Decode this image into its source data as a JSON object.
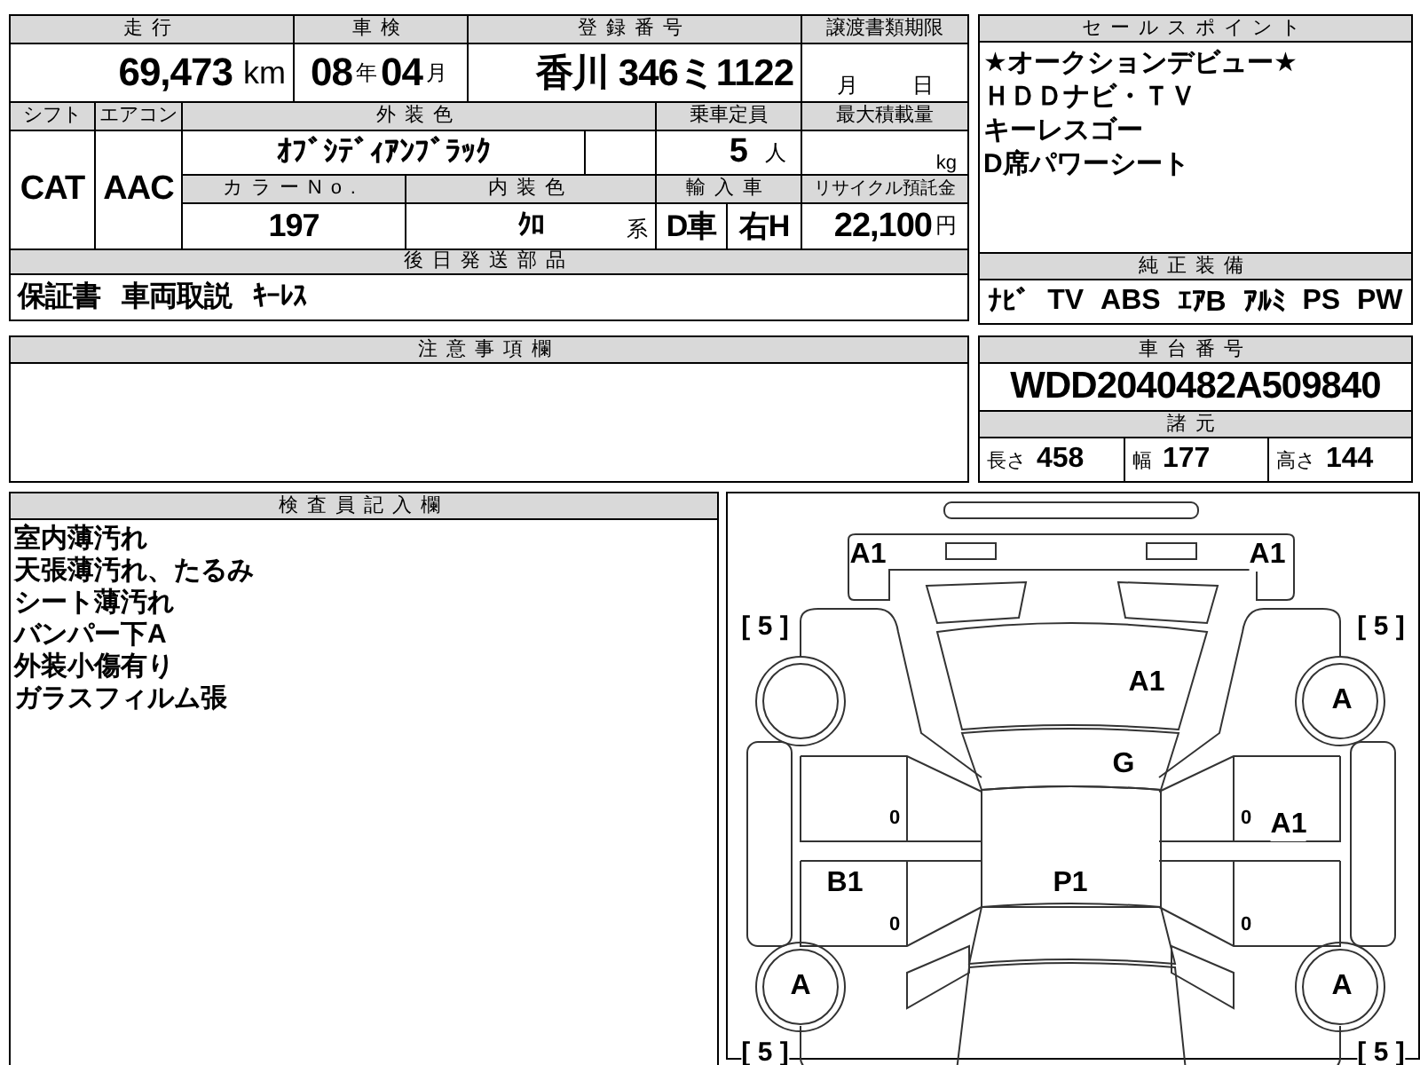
{
  "mileage": {
    "label": "走行",
    "value": "69,473",
    "unit": "km"
  },
  "inspection": {
    "label": "車検",
    "year": "08",
    "year_unit": "年",
    "month": "04",
    "month_unit": "月"
  },
  "registration": {
    "label": "登録番号",
    "value": "香川 346ミ1122"
  },
  "transfer_deadline": {
    "label": "譲渡書類期限",
    "month_unit": "月",
    "day_unit": "日"
  },
  "shift": {
    "label": "シフト",
    "value": "CAT"
  },
  "aircon": {
    "label": "エアコン",
    "value": "AAC"
  },
  "exterior_color": {
    "label": "外装色",
    "value": "ｵﾌﾞｼﾃﾞｨｱﾝﾌﾞﾗｯｸ"
  },
  "capacity": {
    "label": "乗車定員",
    "value": "5",
    "unit": "人"
  },
  "max_load": {
    "label": "最大積載量",
    "unit": "kg"
  },
  "color_no": {
    "label": "カラーNo.",
    "value": "197"
  },
  "interior_color": {
    "label": "内装色",
    "value": "ｸﾛ",
    "suffix": "系"
  },
  "import": {
    "label": "輸入車",
    "drive": "D車",
    "handle": "右H"
  },
  "recycle_fee": {
    "label": "リサイクル預託金",
    "value": "22,100",
    "unit": "円"
  },
  "later_parts": {
    "label": "後日発送部品",
    "items": [
      "保証書",
      "車両取説",
      "ｷｰﾚｽ"
    ]
  },
  "sales_points": {
    "label": "セールスポイント",
    "lines": [
      "★オークションデビュー★",
      "ＨＤＤナビ・ＴＶ",
      "キーレスゴー",
      "D席パワーシート"
    ]
  },
  "factory_equipment": {
    "label": "純正装備",
    "items": [
      "ﾅﾋﾞ",
      "TV",
      "ABS",
      "ｴｱB",
      "ｱﾙﾐ",
      "PS",
      "PW"
    ]
  },
  "notes": {
    "label": "注意事項欄"
  },
  "chassis": {
    "label": "車台番号",
    "value": "WDD2040482A509840"
  },
  "specs": {
    "label": "諸元",
    "items": [
      {
        "label": "長さ",
        "value": "458"
      },
      {
        "label": "幅",
        "value": "177"
      },
      {
        "label": "高さ",
        "value": "144"
      }
    ]
  },
  "inspector": {
    "label": "検査員記入欄",
    "lines": [
      "室内薄汚れ",
      "天張薄汚れ、たるみ",
      "シート薄汚れ",
      "バンパー下A",
      "外装小傷有り",
      "ガラスフィルム張"
    ]
  },
  "diagram": {
    "marks": [
      {
        "kind": "damage",
        "text": "A1"
      },
      {
        "kind": "damage",
        "text": "A1"
      },
      {
        "kind": "tread",
        "text": "[ 5 ]"
      },
      {
        "kind": "tread",
        "text": "[ 5 ]"
      },
      {
        "kind": "damage",
        "text": "A1"
      },
      {
        "kind": "tire",
        "text": "A"
      },
      {
        "kind": "damage",
        "text": "G"
      },
      {
        "kind": "zero",
        "text": "0"
      },
      {
        "kind": "zero",
        "text": "0"
      },
      {
        "kind": "damage",
        "text": "A1"
      },
      {
        "kind": "damage",
        "text": "B1"
      },
      {
        "kind": "damage",
        "text": "P1"
      },
      {
        "kind": "zero",
        "text": "0"
      },
      {
        "kind": "zero",
        "text": "0"
      },
      {
        "kind": "tire",
        "text": "A"
      },
      {
        "kind": "tire",
        "text": "A"
      },
      {
        "kind": "tread",
        "text": "[ 5 ]"
      },
      {
        "kind": "tread",
        "text": "[ 5 ]"
      }
    ]
  }
}
